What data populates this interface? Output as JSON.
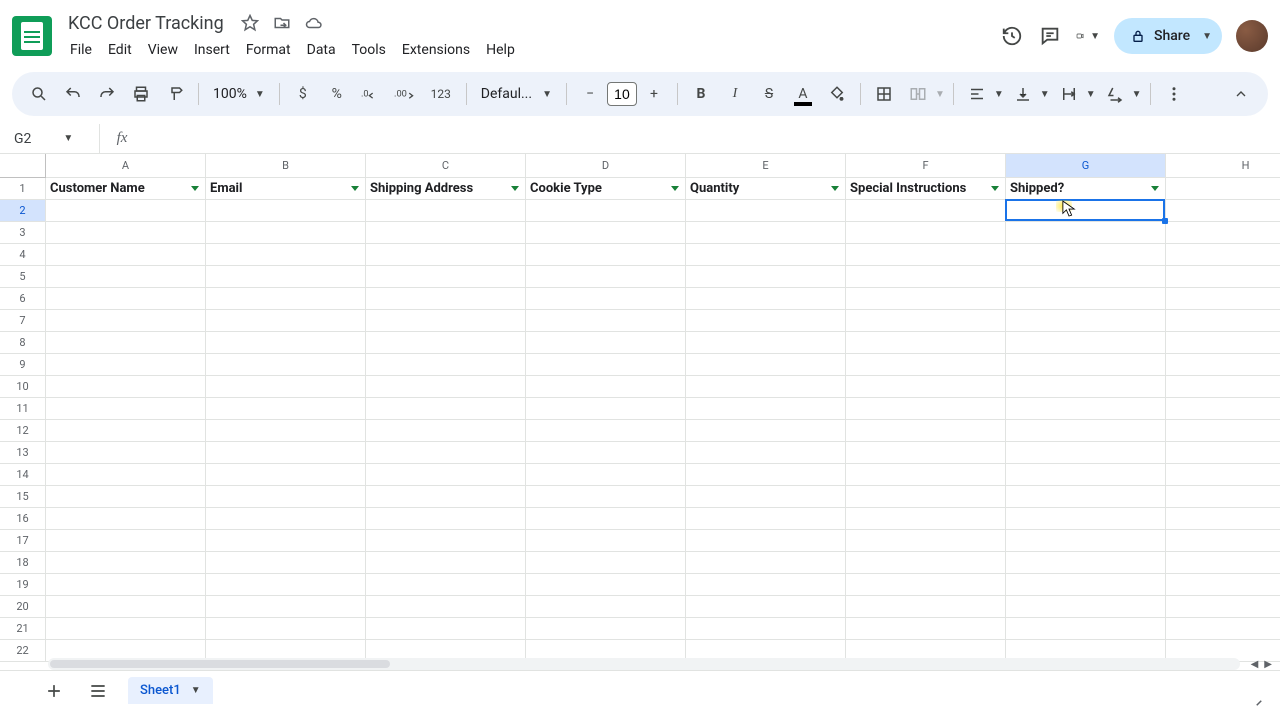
{
  "doc_title": "KCC Order Tracking",
  "menus": [
    "File",
    "Edit",
    "View",
    "Insert",
    "Format",
    "Data",
    "Tools",
    "Extensions",
    "Help"
  ],
  "share_label": "Share",
  "toolbar": {
    "zoom": "100%",
    "currency": "$",
    "percent": "%",
    "num_fmt": "123",
    "font": "Defaul...",
    "font_size": "10"
  },
  "name_box": "G2",
  "columns": [
    "A",
    "B",
    "C",
    "D",
    "E",
    "F",
    "G",
    "H"
  ],
  "header_row": [
    "Customer Name",
    "Email",
    "Shipping Address",
    "Cookie Type",
    "Quantity",
    "Special Instructions",
    "Shipped?"
  ],
  "row_count": 22,
  "selected_col": "G",
  "selected_row": 2,
  "sheet_tab": "Sheet1"
}
